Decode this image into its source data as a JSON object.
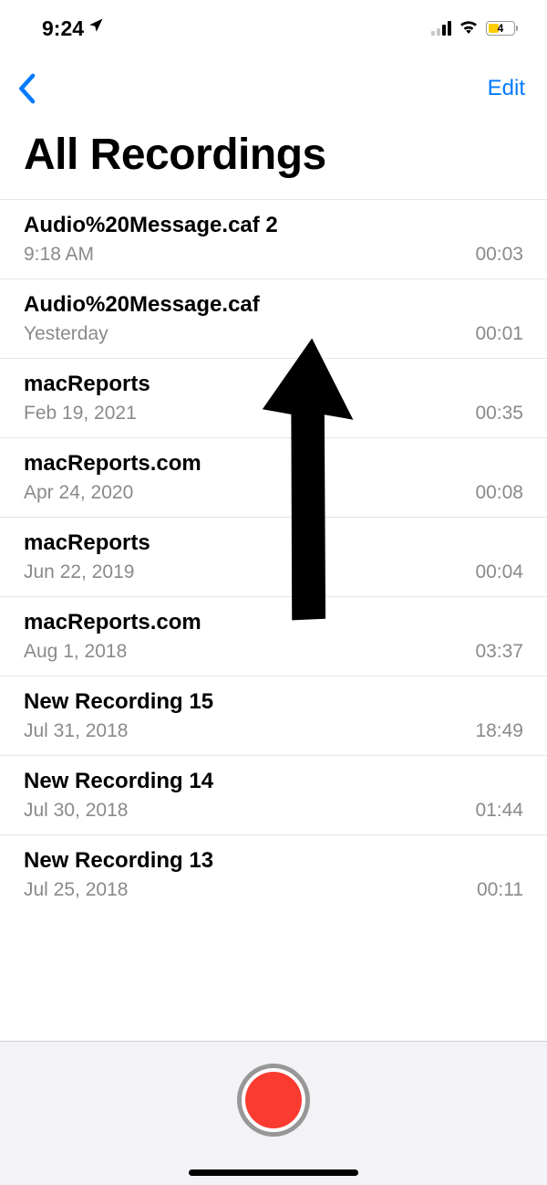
{
  "status": {
    "time": "9:24",
    "battery_percent": "4"
  },
  "nav": {
    "edit_label": "Edit"
  },
  "title": "All Recordings",
  "recordings": [
    {
      "title": "Audio%20Message.caf 2",
      "date": "9:18 AM",
      "duration": "00:03"
    },
    {
      "title": "Audio%20Message.caf",
      "date": "Yesterday",
      "duration": "00:01"
    },
    {
      "title": "macReports",
      "date": "Feb 19, 2021",
      "duration": "00:35"
    },
    {
      "title": "macReports.com",
      "date": "Apr 24, 2020",
      "duration": "00:08"
    },
    {
      "title": "macReports",
      "date": "Jun 22, 2019",
      "duration": "00:04"
    },
    {
      "title": "macReports.com",
      "date": "Aug 1, 2018",
      "duration": "03:37"
    },
    {
      "title": "New Recording 15",
      "date": "Jul 31, 2018",
      "duration": "18:49"
    },
    {
      "title": "New Recording 14",
      "date": "Jul 30, 2018",
      "duration": "01:44"
    },
    {
      "title": "New Recording 13",
      "date": "Jul 25, 2018",
      "duration": "00:11"
    }
  ]
}
